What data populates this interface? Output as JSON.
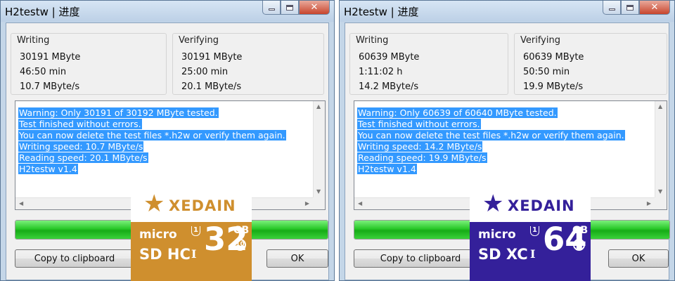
{
  "colors": {
    "selection": "#3399ff",
    "progress": "#22c322",
    "card_gold": "#cf8f2e",
    "card_purple": "#34209a"
  },
  "left": {
    "title": "H2testw | 进度",
    "writing": {
      "label": "Writing",
      "size": "30191 MByte",
      "time": "46:50 min",
      "speed": "10.7 MByte/s"
    },
    "verifying": {
      "label": "Verifying",
      "size": "30191 MByte",
      "time": "25:00 min",
      "speed": "20.1 MByte/s"
    },
    "log": [
      "Warning: Only 30191 of 30192 MByte tested.",
      "Test finished without errors.",
      "You can now delete the test files *.h2w or verify them again.",
      "Writing speed: 10.7 MByte/s",
      "Reading speed: 20.1 MByte/s",
      "H2testw v1.4"
    ],
    "progress": 1.0,
    "copy_label": "Copy to clipboard",
    "ok_label": "OK"
  },
  "right": {
    "title": "H2testw | 进度",
    "writing": {
      "label": "Writing",
      "size": "60639 MByte",
      "time": "1:11:02 h",
      "speed": "14.2 MByte/s"
    },
    "verifying": {
      "label": "Verifying",
      "size": "60639 MByte",
      "time": "50:50 min",
      "speed": "19.9 MByte/s"
    },
    "log": [
      "Warning: Only 60639 of 60640 MByte tested.",
      "Test finished without errors.",
      "You can now delete the test files *.h2w or verify them again.",
      "Writing speed: 14.2 MByte/s",
      "Reading speed: 19.9 MByte/s",
      "H2testw v1.4"
    ],
    "progress": 1.0,
    "copy_label": "Copy to clipboard",
    "ok_label": "OK"
  },
  "card32": {
    "brand": "XEDAIN",
    "micro": "micro",
    "class": "SD HC",
    "u1": "1",
    "roman": "I",
    "capacity": "32",
    "unit": "GB",
    "speed_class": "10"
  },
  "card64": {
    "brand": "XEDAIN",
    "micro": "micro",
    "class": "SD XC",
    "u1": "1",
    "roman": "I",
    "capacity": "64",
    "unit": "GB",
    "speed_class": "10"
  },
  "icons": {
    "minimize": "minimize-icon",
    "maximize": "maximize-icon",
    "close": "close-icon",
    "star": "star-logo-icon"
  }
}
